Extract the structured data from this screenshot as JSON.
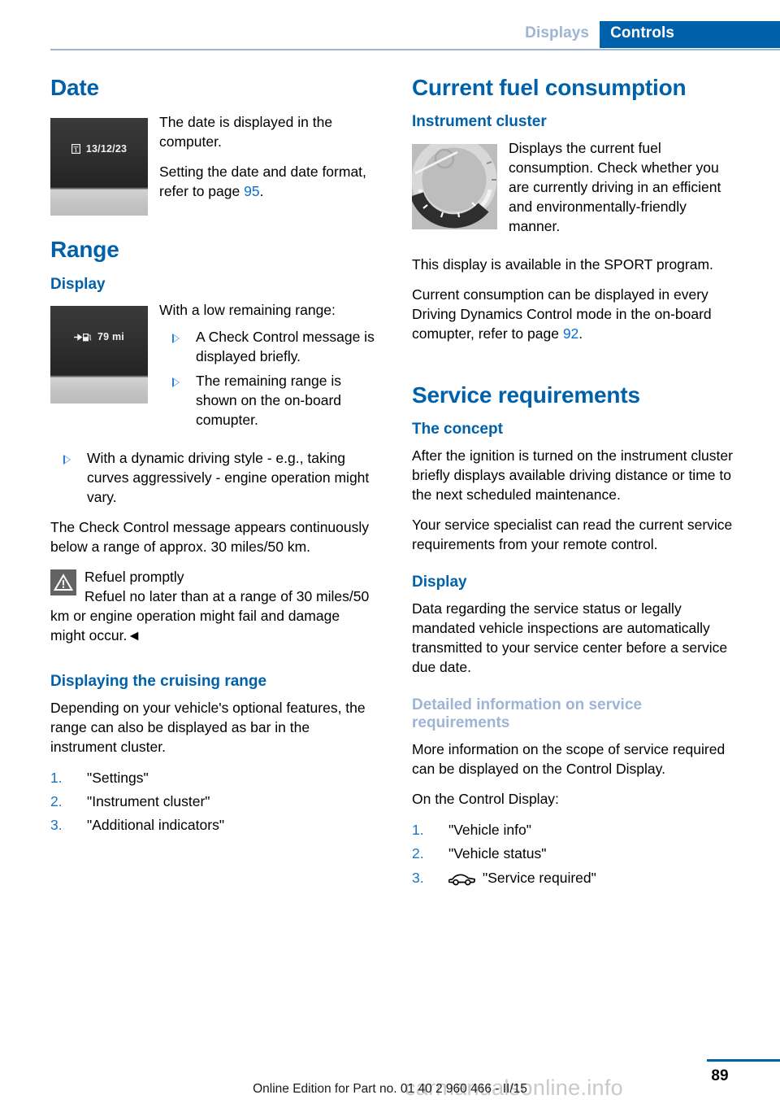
{
  "header": {
    "tab_inactive": "Displays",
    "tab_active": "Controls",
    "accent_color": "#0061ab",
    "muted_blue": "#9db4d4"
  },
  "left_column": {
    "date": {
      "heading": "Date",
      "figure": {
        "icon": "calendar-icon",
        "value": "13/12/23"
      },
      "paragraphs": [
        "The date is displayed in the computer.",
        "Setting the date and date format, refer to page "
      ],
      "page_ref": "95",
      "page_ref_suffix": "."
    },
    "range": {
      "heading": "Range",
      "sub_display": "Display",
      "figure": {
        "icon": "fuel-pump-arrow-icon",
        "value": "79 mi"
      },
      "intro": "With a low remaining range:",
      "bullets": [
        "A Check Control message is displayed briefly.",
        "The remaining range is shown on the on-board comupter.",
        "With a dynamic driving style - e.g., taking curves aggressively - engine operation might vary."
      ],
      "after_bullets": "The Check Control message appears continuously below a range of approx. 30 miles/50 km.",
      "warning": {
        "icon": "warning-triangle-icon",
        "title": "Refuel promptly",
        "body": "Refuel no later than at a range of 30 miles/50 km or engine operation might fail and damage might occur.◄"
      }
    },
    "cruising": {
      "heading": "Displaying the cruising range",
      "paragraph": "Depending on your vehicle's optional features, the range can also be displayed as bar in the instrument cluster.",
      "steps": [
        {
          "num": "1.",
          "label": "\"Settings\""
        },
        {
          "num": "2.",
          "label": "\"Instrument cluster\""
        },
        {
          "num": "3.",
          "label": "\"Additional indicators\""
        }
      ]
    }
  },
  "right_column": {
    "fuel": {
      "heading": "Current fuel consumption",
      "sub_cluster": "Instrument cluster",
      "figure": {
        "icon": "consumption-gauge-image"
      },
      "figure_text": "Displays the current fuel consumption. Check whether you are currently driving in an efficient and environmentally-friendly manner.",
      "paragraph_sport": "This display is available in the SPORT program.",
      "paragraph_modes_prefix": "Current consumption can be displayed in every Driving Dynamics Control mode in the on-board comupter, refer to page ",
      "page_ref": "92",
      "page_ref_suffix": "."
    },
    "service": {
      "heading": "Service requirements",
      "concept_heading": "The concept",
      "concept_p1": "After the ignition is turned on the instrument cluster briefly displays available driving distance or time to the next scheduled maintenance.",
      "concept_p2": "Your service specialist can read the current service requirements from your remote control.",
      "display_heading": "Display",
      "display_p1": "Data regarding the service status or legally mandated vehicle inspections are automatically transmitted to your service center before a service due date.",
      "detailed_heading": "Detailed information on service requirements",
      "detailed_p1": "More information on the scope of service required can be displayed on the Control Display.",
      "detailed_p2": "On the Control Display:",
      "steps": [
        {
          "num": "1.",
          "label": "\"Vehicle info\"",
          "icon": ""
        },
        {
          "num": "2.",
          "label": "\"Vehicle status\"",
          "icon": ""
        },
        {
          "num": "3.",
          "label": "\"Service required\"",
          "icon": "car-icon"
        }
      ]
    }
  },
  "footer": {
    "page_number": "89",
    "edition_note": "Online Edition for Part no. 01 40 2 960 466 - II/15",
    "watermark": "carmanualsonline.info"
  }
}
